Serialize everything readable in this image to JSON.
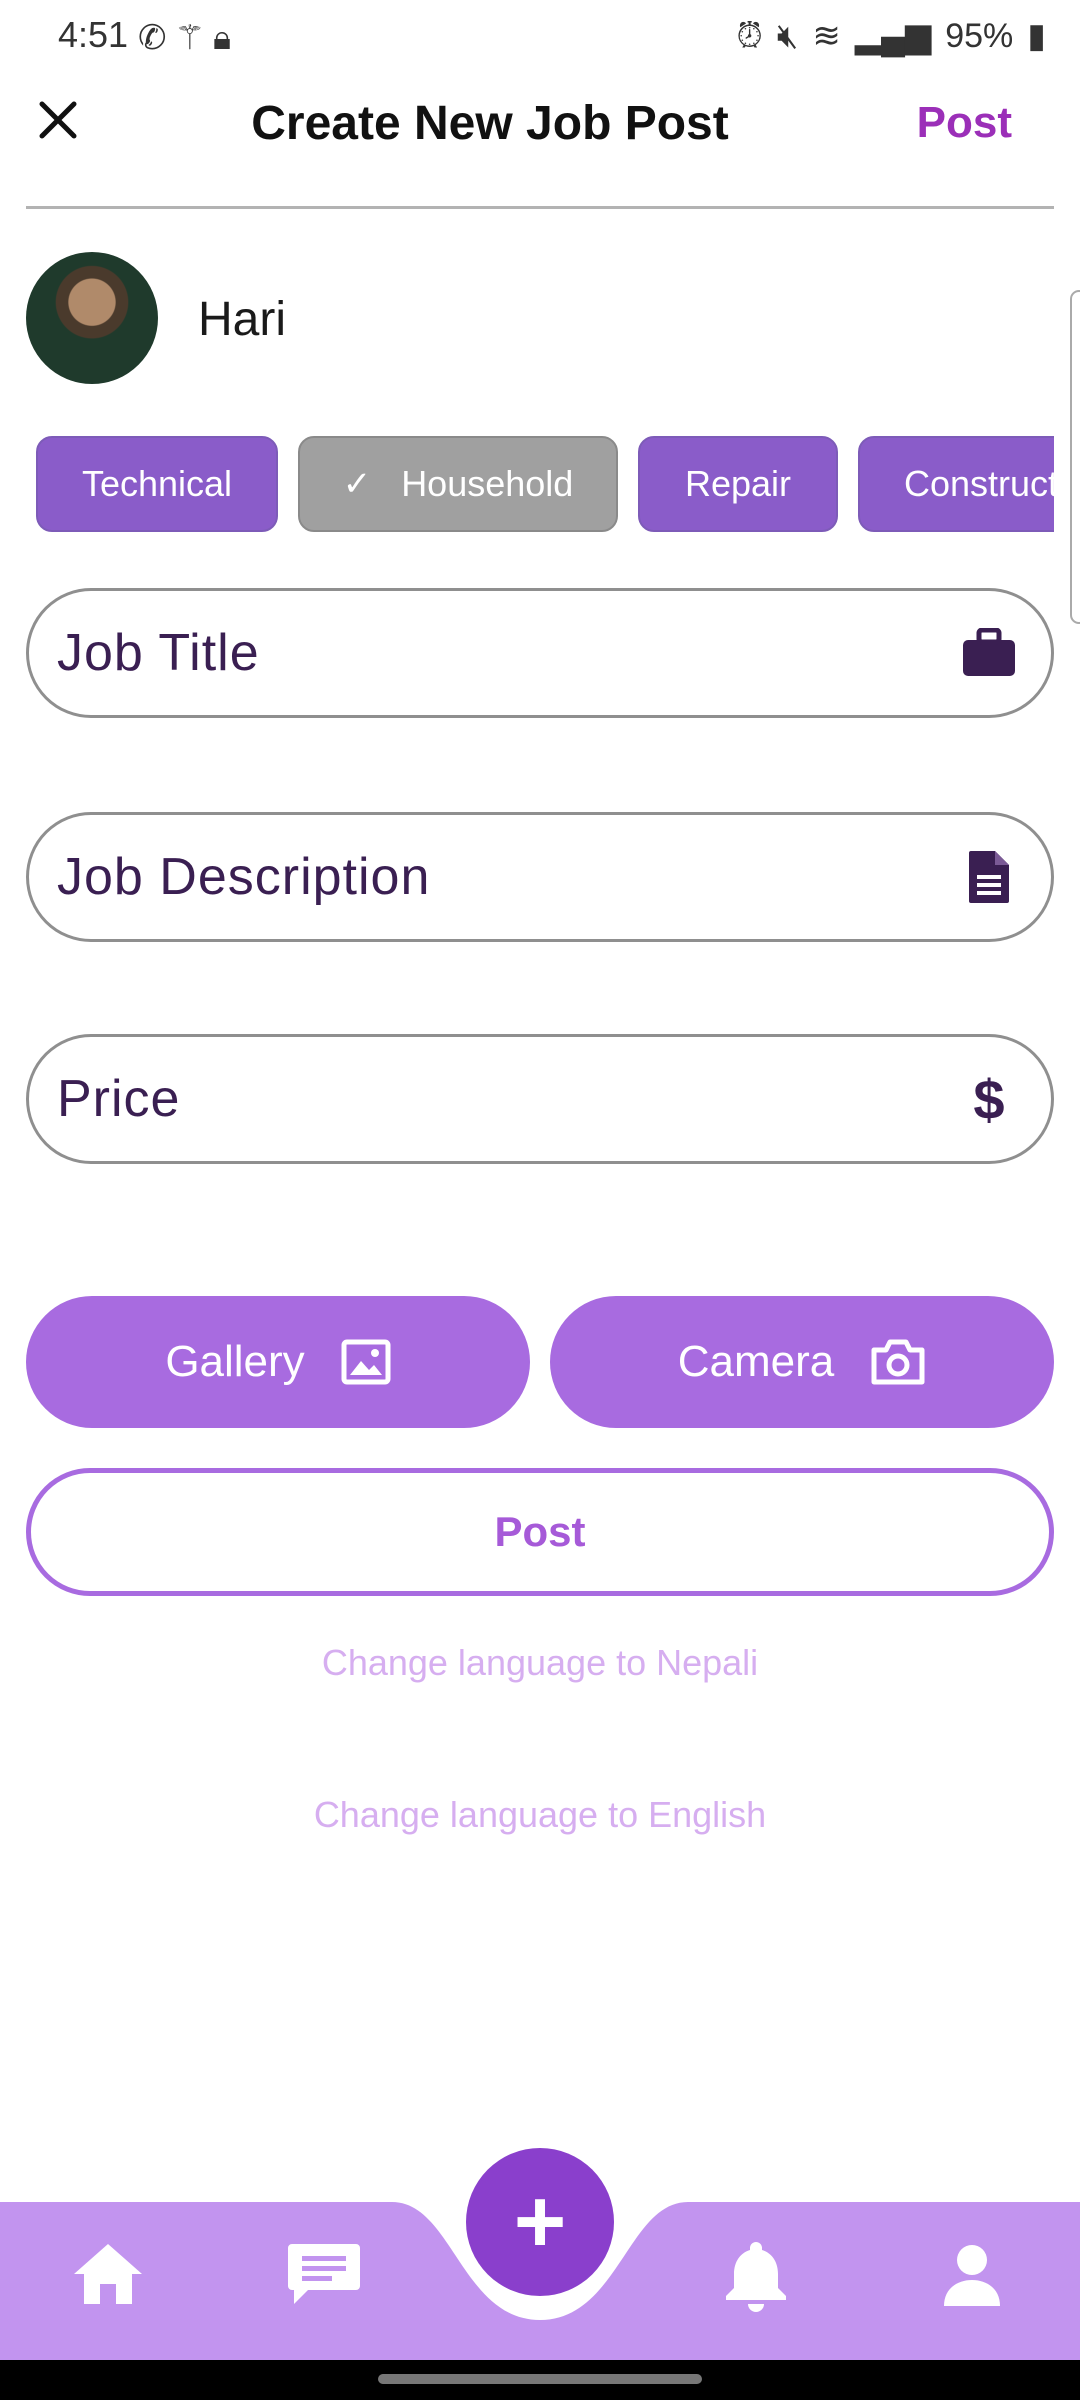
{
  "status_bar": {
    "time": "4:51",
    "battery": "95%"
  },
  "header": {
    "title": "Create New Job Post",
    "post_label": "Post"
  },
  "user": {
    "name": "Hari"
  },
  "categories": [
    {
      "label": "Technical",
      "selected": false
    },
    {
      "label": "Household",
      "selected": true
    },
    {
      "label": "Repair",
      "selected": false
    },
    {
      "label": "Construct",
      "selected": false
    }
  ],
  "fields": {
    "job_title": {
      "placeholder": "Job Title",
      "icon": "briefcase-icon"
    },
    "job_description": {
      "placeholder": "Job Description",
      "icon": "document-icon"
    },
    "price": {
      "placeholder": "Price",
      "icon": "dollar-icon"
    }
  },
  "buttons": {
    "gallery": "Gallery",
    "camera": "Camera",
    "post": "Post"
  },
  "language": {
    "nepali": "Change language to Nepali",
    "english": "Change language to English"
  },
  "colors": {
    "accent": "#a86be0",
    "nav_bg": "#c294ef",
    "fab": "#8a3fcc",
    "post_text": "#9b2fb8",
    "field_text": "#3a1f52"
  },
  "nav": [
    "home-icon",
    "chat-icon",
    "add-icon",
    "bell-icon",
    "profile-icon"
  ]
}
